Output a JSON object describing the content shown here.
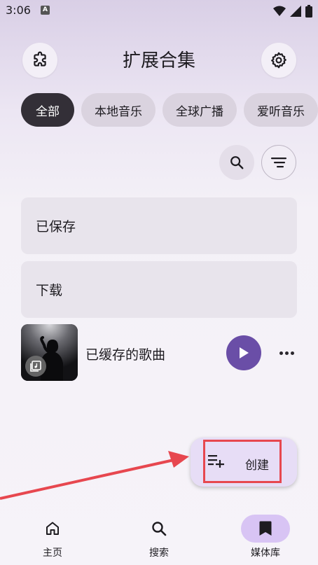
{
  "status_bar": {
    "time": "3:06",
    "notification_badge": "A",
    "icons": [
      "wifi-icon",
      "signal-icon",
      "battery-icon"
    ]
  },
  "header": {
    "title": "扩展合集",
    "left_icon": "puzzle-icon",
    "right_icon": "gear-icon"
  },
  "chips": [
    {
      "label": "全部",
      "active": true
    },
    {
      "label": "本地音乐",
      "active": false
    },
    {
      "label": "全球广播",
      "active": false
    },
    {
      "label": "爱听音乐",
      "active": false
    }
  ],
  "actions": {
    "search_icon": "search-icon",
    "sort_icon": "sort-icon"
  },
  "library": {
    "saved_label": "已保存",
    "downloads_label": "下载",
    "cached_label": "已缓存的歌曲"
  },
  "fab": {
    "label": "创建",
    "icon": "playlist-add-icon"
  },
  "bottom_nav": [
    {
      "label": "主页",
      "icon": "home-icon",
      "active": false
    },
    {
      "label": "搜索",
      "icon": "search-icon",
      "active": false
    },
    {
      "label": "媒体库",
      "icon": "bookmark-icon",
      "active": true
    }
  ],
  "colors": {
    "accent": "#6a4ea7",
    "active_chip": "#332f37",
    "nav_pill": "#d8c4f4",
    "highlight": "#e7474f"
  }
}
